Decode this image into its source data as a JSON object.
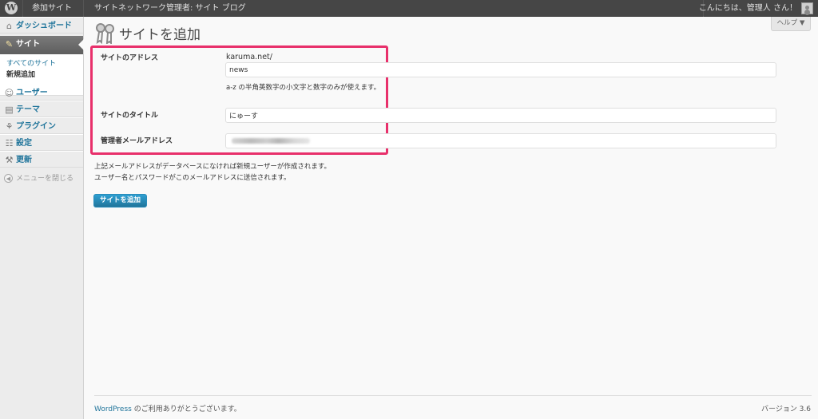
{
  "adminbar": {
    "logo_glyph": "W",
    "my_sites": "参加サイト",
    "network_admin": "サイトネットワーク管理者: サイト ブログ",
    "greeting": "こんにちは、管理人 さん！"
  },
  "sidebar": {
    "items": [
      {
        "label": "ダッシュボード",
        "icon": "dashboard-icon"
      },
      {
        "label": "サイト",
        "icon": "sites-icon"
      },
      {
        "label": "ユーザー",
        "icon": "users-icon"
      },
      {
        "label": "テーマ",
        "icon": "themes-icon"
      },
      {
        "label": "プラグイン",
        "icon": "plugins-icon"
      },
      {
        "label": "設定",
        "icon": "settings-icon"
      },
      {
        "label": "更新",
        "icon": "updates-icon"
      }
    ],
    "submenu": {
      "all_sites": "すべてのサイト",
      "add_new": "新規追加"
    },
    "collapse": "メニューを閉じる"
  },
  "header": {
    "title": "サイトを追加",
    "help": "ヘルプ ▼"
  },
  "form": {
    "address_label": "サイトのアドレス",
    "domain": "karuma.net/",
    "address_value": "news",
    "address_desc": "a-z の半角英数字の小文字と数字のみが使えます。",
    "title_label": "サイトのタイトル",
    "title_value": "にゅーす",
    "email_label": "管理者メールアドレス",
    "email_value": ""
  },
  "notes": {
    "line1": "上記メールアドレスがデータベースになければ新規ユーザーが作成されます。",
    "line2": "ユーザー名とパスワードがこのメールアドレスに送信されます。"
  },
  "submit_label": "サイトを追加",
  "footer": {
    "wp_link": "WordPress",
    "thanks": " のご利用ありがとうございます。",
    "version": "バージョン 3.6"
  },
  "colors": {
    "link": "#21759b",
    "highlight_border": "#e8306b",
    "adminbar_bg": "#464646"
  }
}
